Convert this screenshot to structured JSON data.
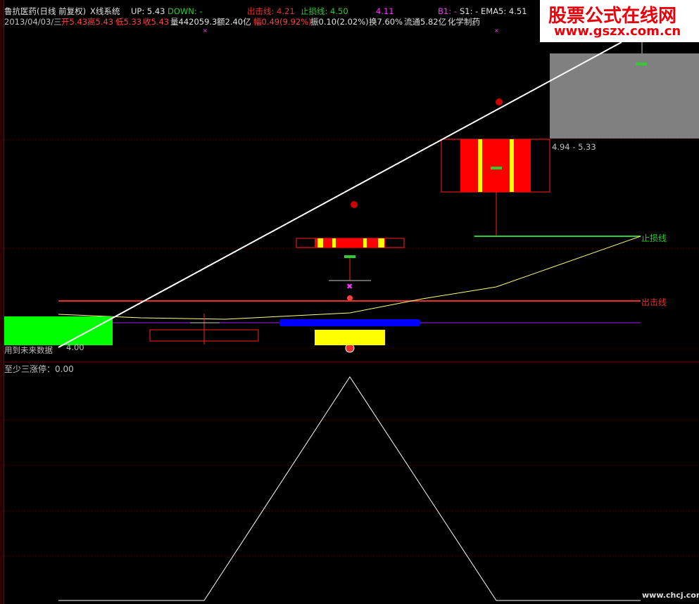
{
  "header": {
    "title": "鲁抗医药(日线 前复权)",
    "system": "X线系统",
    "up_label": "UP: 5.43",
    "down_label": "DOWN: -",
    "exit_line": "出击线: 4.21",
    "stop_line": "止损线: 4.50",
    "value3": "4.11",
    "b1": "B1: -",
    "s1": "S1: -",
    "ema5": "EMA5: 4.51"
  },
  "info_row": {
    "date": "2013/04/03/三",
    "open": "开5.43",
    "high": "高5.43",
    "low": "低5.33",
    "close": "收5.43",
    "volume": "量442059.3",
    "amount": "额2.40亿",
    "change": "幅0.49(9.92%)",
    "amplitude": "振0.10(2.02%)",
    "turnover": "换7.60%",
    "float_cap": "流通5.82亿",
    "sector": "化学制药"
  },
  "watermark": {
    "title": "股票公式在线网",
    "url": "www.gszx.com.cn",
    "bottom": "www.chcj.com"
  },
  "chart_labels": {
    "range": "4.94 - 5.33",
    "stop": "止损线",
    "exit": "出击线",
    "low_value": "4.00",
    "future_note": "用到未来数据",
    "sub_indicator": "至少三涨停：0.00"
  },
  "colors": {
    "background": "#000000",
    "up_red": "#ff0000",
    "stop_green": "#2ecc2e",
    "exit_red": "#e8302a",
    "yellow": "#ffff00",
    "blue": "#0000ff",
    "bright_green": "#00ff00",
    "gray_box": "#808080",
    "purple": "#a020f0",
    "white": "#ffffff"
  }
}
